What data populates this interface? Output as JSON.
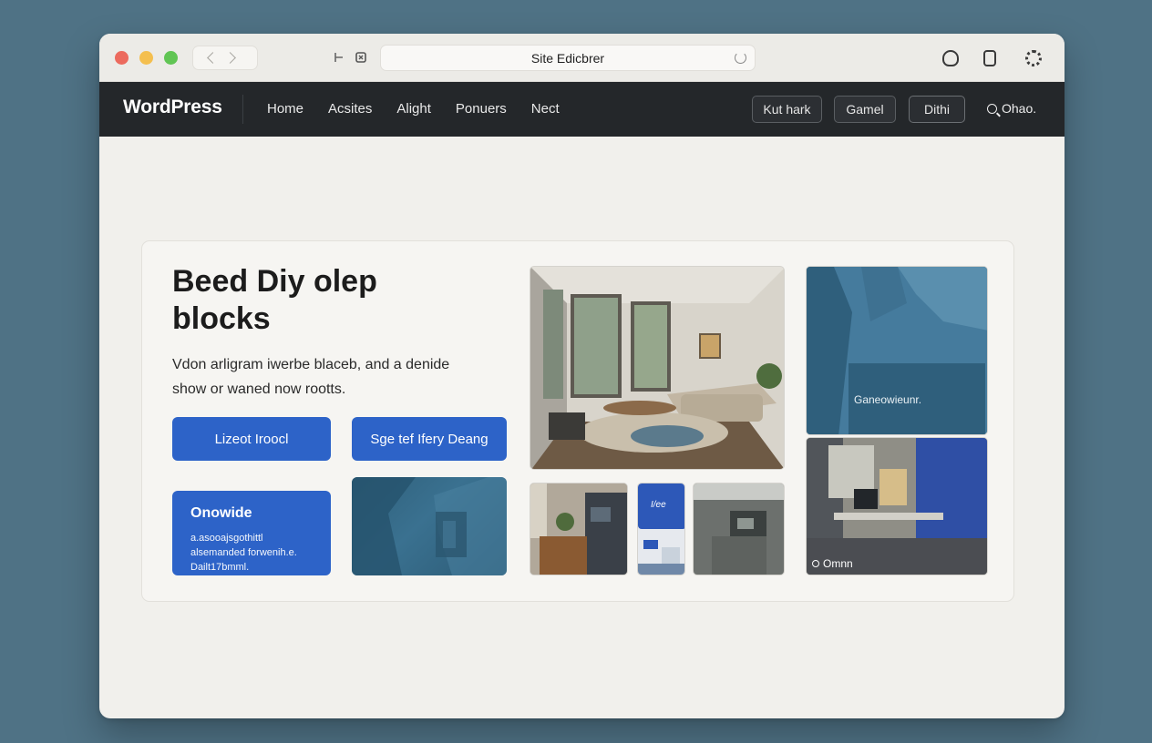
{
  "browser": {
    "title": "Site Edicbrer"
  },
  "header": {
    "logo": "WordPress",
    "nav": [
      "Home",
      "Acsites",
      "Alight",
      "Ponuers",
      "Nect"
    ],
    "buttons": [
      "Kut hark",
      "Gamel",
      "Dithi"
    ],
    "search_label": "Ohao."
  },
  "hero": {
    "title": "Beed Diy olep blocks",
    "description": "Vdon arligram iwerbe blaceb, and a denide show or waned now rootts.",
    "primary_button": "Lizeot Iroocl",
    "secondary_button": "Sge tef Ifery Deang",
    "info_tile": {
      "title": "Onowide",
      "description": "a.asooajsgothittl alsemanded forwenih.e. Dailt17bmml."
    }
  },
  "gallery": {
    "blue_caption": "Ganeowieunr.",
    "office_label": "Omnn",
    "thumb_label": "I/ee"
  },
  "colors": {
    "accent": "#2d63c8",
    "appbar": "#24272a",
    "desktop": "#4f7285"
  }
}
